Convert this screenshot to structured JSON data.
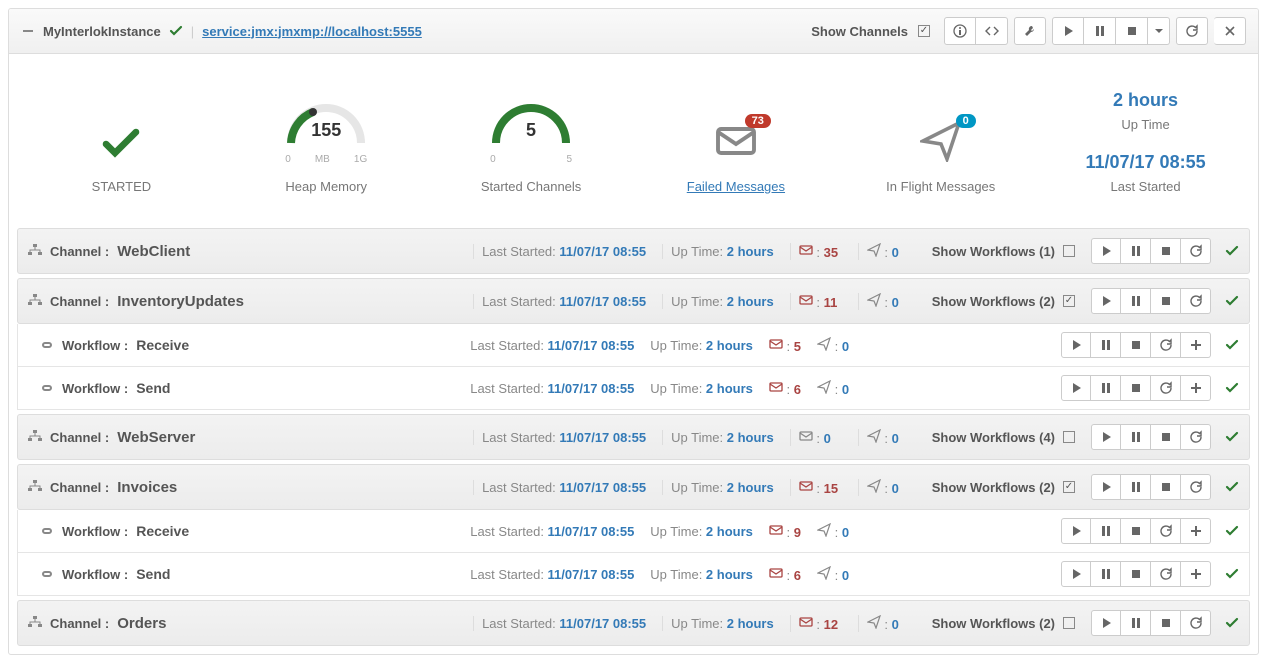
{
  "header": {
    "instance_name": "MyInterlokInstance",
    "jmx_url": "service:jmx:jmxmp://localhost:5555",
    "show_channels_label": "Show Channels",
    "show_channels_checked": true
  },
  "dashboard": {
    "status": {
      "value": "STARTED"
    },
    "heap": {
      "label": "Heap Memory",
      "value": "155",
      "min": "0",
      "max": "1G",
      "unit": "MB"
    },
    "started_channels": {
      "label": "Started Channels",
      "value": "5",
      "min": "0",
      "max": "5"
    },
    "failed": {
      "label": "Failed Messages",
      "count": "73"
    },
    "inflight": {
      "label": "In Flight Messages",
      "count": "0"
    },
    "uptime": {
      "value": "2 hours",
      "label": "Up Time"
    },
    "last_started": {
      "value": "11/07/17 08:55",
      "label": "Last Started"
    }
  },
  "labels": {
    "channel": "Channel :",
    "workflow": "Workflow :",
    "last_started": "Last Started:",
    "up_time": "Up Time:",
    "show_workflows": "Show Workflows"
  },
  "channels": [
    {
      "name": "WebClient",
      "last_started": "11/07/17 08:55",
      "up_time": "2 hours",
      "failed": "35",
      "inflight": "0",
      "wf_count": "1",
      "expanded": false,
      "workflows": []
    },
    {
      "name": "InventoryUpdates",
      "last_started": "11/07/17 08:55",
      "up_time": "2 hours",
      "failed": "11",
      "inflight": "0",
      "wf_count": "2",
      "expanded": true,
      "workflows": [
        {
          "name": "Receive",
          "last_started": "11/07/17 08:55",
          "up_time": "2 hours",
          "failed": "5",
          "inflight": "0"
        },
        {
          "name": "Send",
          "last_started": "11/07/17 08:55",
          "up_time": "2 hours",
          "failed": "6",
          "inflight": "0"
        }
      ]
    },
    {
      "name": "WebServer",
      "last_started": "11/07/17 08:55",
      "up_time": "2 hours",
      "failed": "0",
      "inflight": "0",
      "wf_count": "4",
      "expanded": false,
      "workflows": []
    },
    {
      "name": "Invoices",
      "last_started": "11/07/17 08:55",
      "up_time": "2 hours",
      "failed": "15",
      "inflight": "0",
      "wf_count": "2",
      "expanded": true,
      "workflows": [
        {
          "name": "Receive",
          "last_started": "11/07/17 08:55",
          "up_time": "2 hours",
          "failed": "9",
          "inflight": "0"
        },
        {
          "name": "Send",
          "last_started": "11/07/17 08:55",
          "up_time": "2 hours",
          "failed": "6",
          "inflight": "0"
        }
      ]
    },
    {
      "name": "Orders",
      "last_started": "11/07/17 08:55",
      "up_time": "2 hours",
      "failed": "12",
      "inflight": "0",
      "wf_count": "2",
      "expanded": false,
      "workflows": []
    }
  ]
}
